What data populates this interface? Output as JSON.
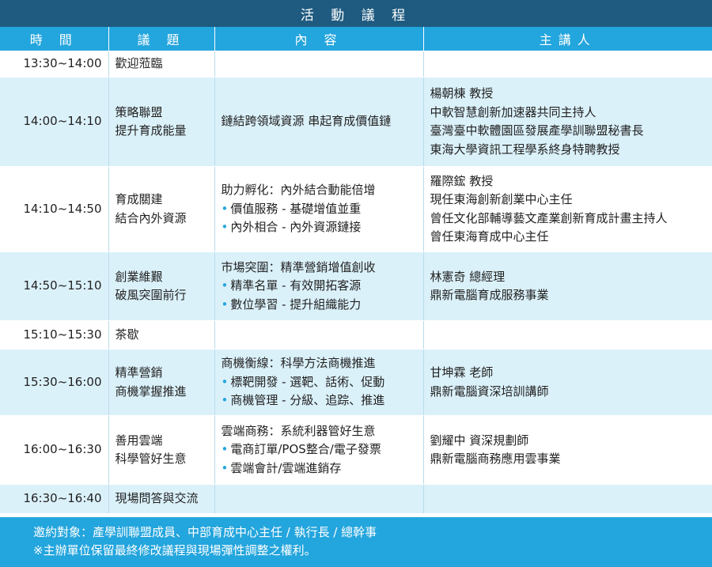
{
  "title": "活 動 議 程",
  "headers": {
    "time": "時 間",
    "topic": "議 題",
    "content": "內 容",
    "speaker": "主講人"
  },
  "rows": [
    {
      "time": "13:30~14:00",
      "topic": [
        "歡迎蒞臨"
      ],
      "content_title": "",
      "content_bullets": [],
      "speaker": []
    },
    {
      "time": "14:00~14:10",
      "topic": [
        "策略聯盟",
        "提升育成能量"
      ],
      "content_title": "鏈結跨領域資源 串起育成價值鏈",
      "content_bullets": [],
      "speaker": [
        "楊朝棟 教授",
        "中軟智慧創新加速器共同主持人",
        "臺灣臺中軟體園區發展產學訓聯盟秘書長",
        "東海大學資訊工程學系終身特聘教授"
      ]
    },
    {
      "time": "14:10~14:50",
      "topic": [
        "育成關建",
        "結合內外資源"
      ],
      "content_title": "助力孵化：內外結合動能倍增",
      "content_bullets": [
        "價值服務 - 基礎增值並重",
        "內外相合 - 內外資源鏈接"
      ],
      "speaker": [
        "羅際鋐 教授",
        "現任東海創新創業中心主任",
        "曾任文化部輔導藝文產業創新育成計畫主持人",
        "曾任東海育成中心主任"
      ]
    },
    {
      "time": "14:50~15:10",
      "topic": [
        "創業維艱",
        "破風突圍前行"
      ],
      "content_title": "市場突圍：精準營銷增值創收",
      "content_bullets": [
        "精準名單 - 有效開拓客源",
        "數位學習 - 提升組織能力"
      ],
      "speaker": [
        "林憲奇 總經理",
        "鼎新電腦育成服務事業"
      ]
    },
    {
      "time": "15:10~15:30",
      "topic": [
        "茶歇"
      ],
      "content_title": "",
      "content_bullets": [],
      "speaker": []
    },
    {
      "time": "15:30~16:00",
      "topic": [
        "精準營銷",
        "商機掌握推進"
      ],
      "content_title": "商機衡線：科學方法商機推進",
      "content_bullets": [
        "標靶開發 - 選靶、話術、促動",
        "商機管理 - 分級、追踪、推進"
      ],
      "speaker": [
        "甘坤霖 老師",
        "鼎新電腦資深培訓講師"
      ]
    },
    {
      "time": "16:00~16:30",
      "topic": [
        "善用雲端",
        "科學管好生意"
      ],
      "content_title": "雲端商務：系統利器管好生意",
      "content_bullets": [
        "電商訂單/POS整合/電子發票",
        "雲端會計/雲端進銷存"
      ],
      "speaker": [
        "劉耀中 資深規劃師",
        "鼎新電腦商務應用雲事業"
      ]
    },
    {
      "time": "16:30~16:40",
      "topic": [
        "現場問答與交流"
      ],
      "content_title": "",
      "content_bullets": [],
      "speaker": []
    }
  ],
  "footer": {
    "line1": "邀約對象：產學訓聯盟成員、中部育成中心主任 / 執行長 / 總幹事",
    "line2": "※主辦單位保留最終修改議程與現場彈性調整之權利。"
  },
  "colors": {
    "title_bg": "#1f5b80",
    "header_bg": "#23a5dd",
    "row_alt_bg": "#dbf1fa",
    "footer_bg": "#23a5dd"
  }
}
